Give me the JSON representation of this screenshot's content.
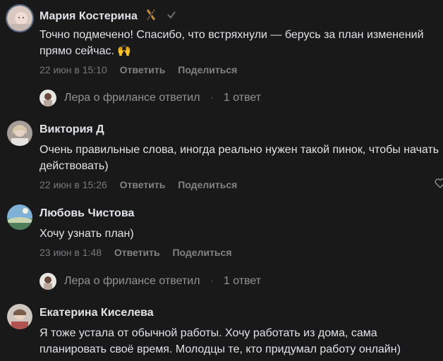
{
  "comments": [
    {
      "author": "Мария Костерина",
      "text": "Точно подмечено! Спасибо, что встряхнули — берусь за план изменений прямо сейчас. 🙌",
      "date": "22 июн в 15:10",
      "reply_label": "Ответить",
      "share_label": "Поделиться",
      "replies": {
        "author_text": "Лера о фрилансе ответил",
        "count_text": "1 ответ"
      }
    },
    {
      "author": "Виктория Д",
      "text": "Очень правильные слова, иногда реально нужен такой пинок, чтобы начать действовать)",
      "date": "22 июн в 15:26",
      "reply_label": "Ответить",
      "share_label": "Поделиться"
    },
    {
      "author": "Любовь Чистова",
      "text": "Хочу узнать план)",
      "date": "23 июн в 1:48",
      "reply_label": "Ответить",
      "share_label": "Поделиться",
      "replies": {
        "author_text": "Лера о фрилансе ответил",
        "count_text": "1 ответ"
      }
    },
    {
      "author": "Екатерина Киселева",
      "text": "Я тоже устала от обычной работы. Хочу работать из дома, сама планировать своё время. Молодцы те, кто придумал работу онлайн)"
    }
  ],
  "colors": {
    "background": "#19191a",
    "text": "#e1e3e6",
    "secondary": "#76787a"
  }
}
